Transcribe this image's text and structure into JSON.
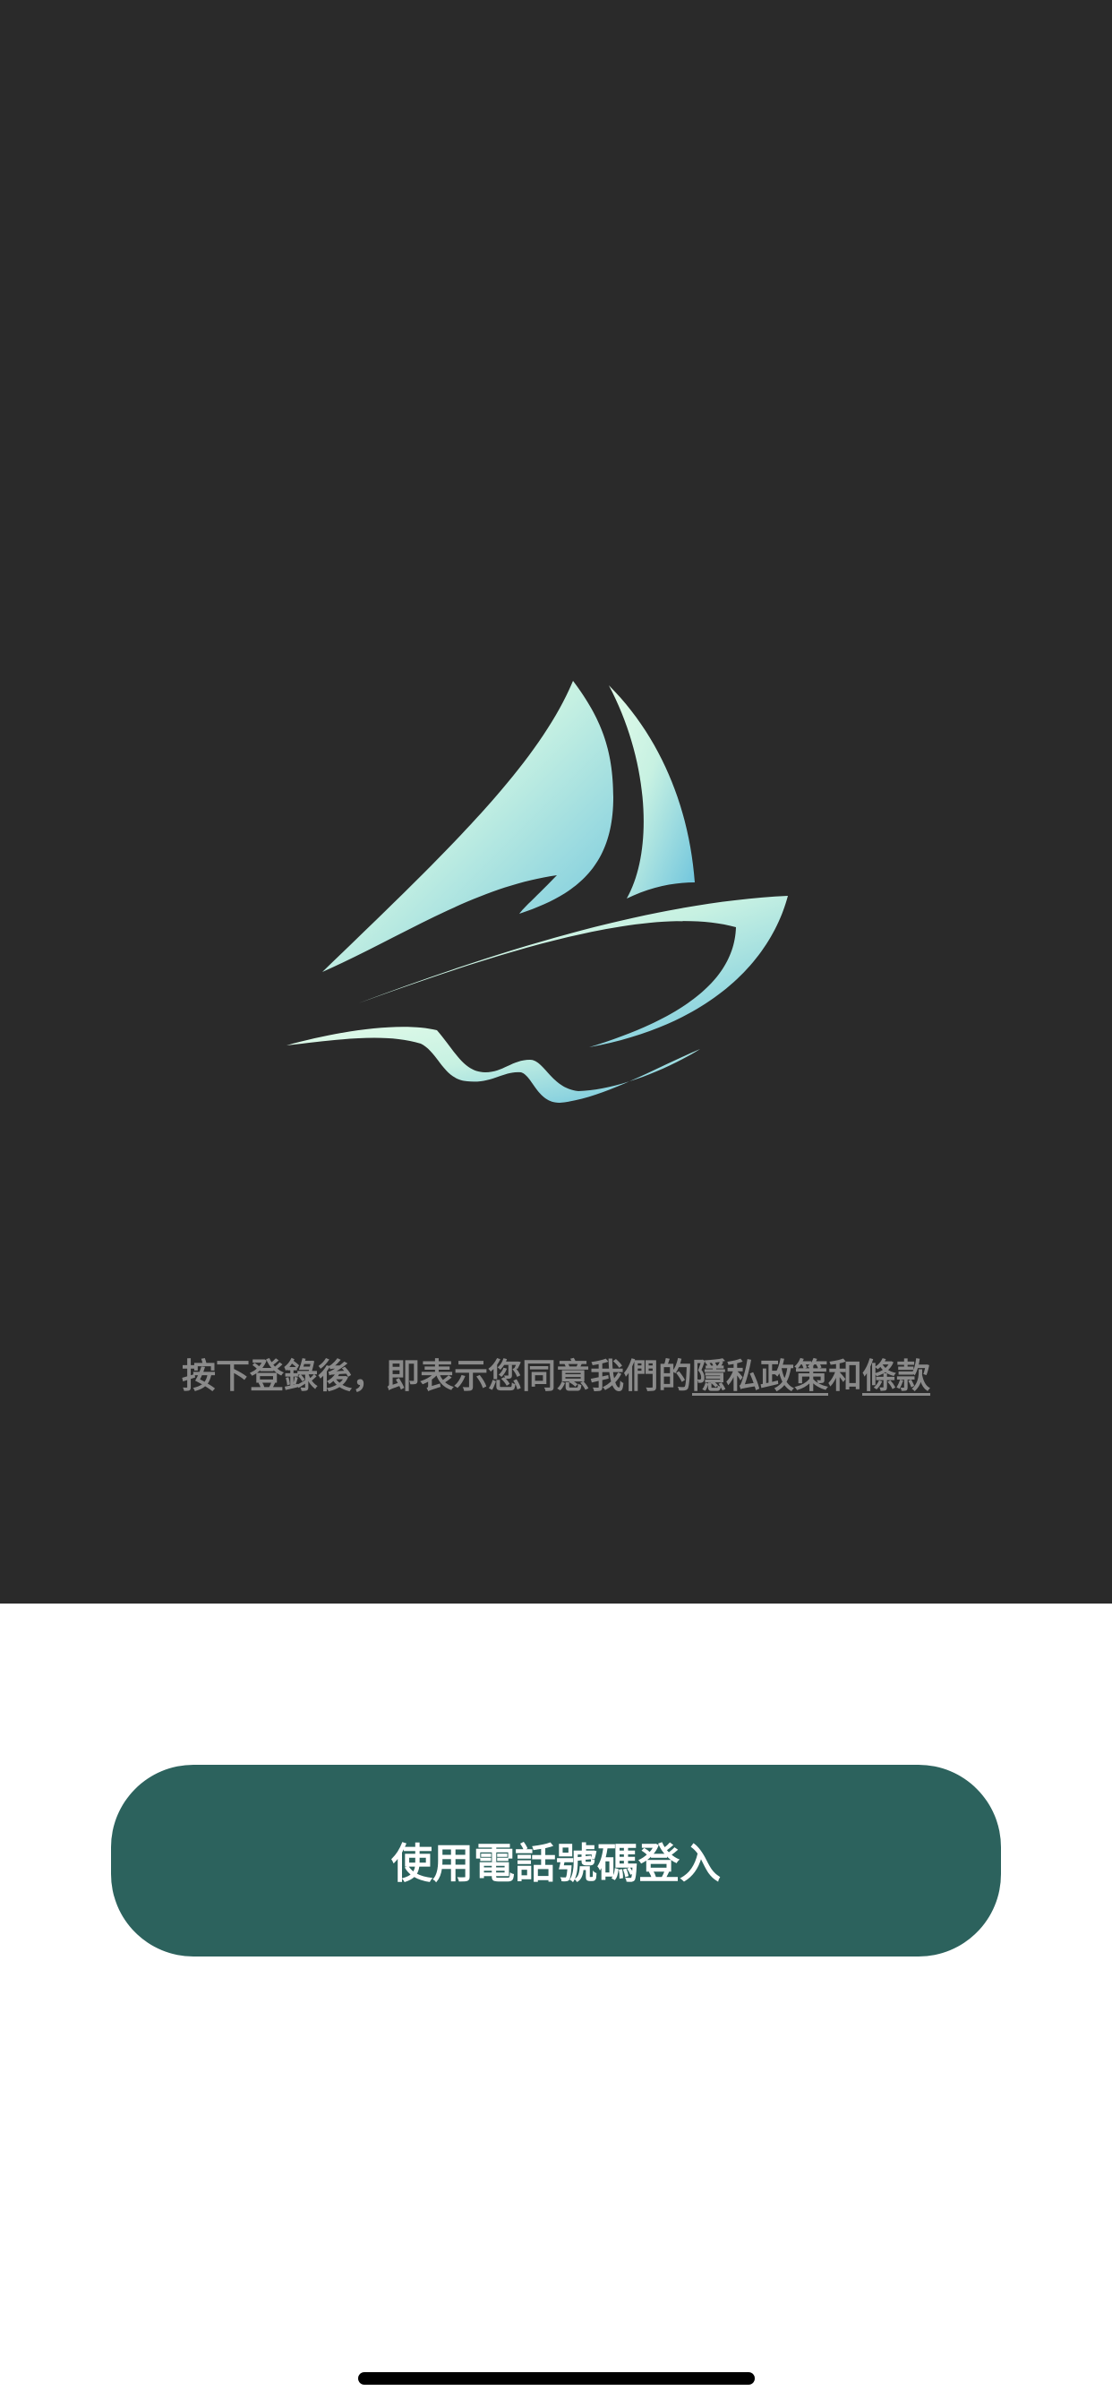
{
  "terms": {
    "prefix": "按下登錄後，即表示您同意我們的",
    "privacy_link": "隱私政策",
    "conjunction": "和",
    "terms_link": "條款"
  },
  "login": {
    "button_label": "使用電話號碼登入"
  },
  "colors": {
    "top_background": "#2a2a2a",
    "bottom_background": "#ffffff",
    "button_background": "#2c625d",
    "terms_text": "#8a8a8a",
    "logo_gradient_start": "#e2fbe9",
    "logo_gradient_end": "#6cc3dd"
  },
  "icons": {
    "logo": "sailboat-logo-icon",
    "home_indicator": "home-indicator"
  }
}
